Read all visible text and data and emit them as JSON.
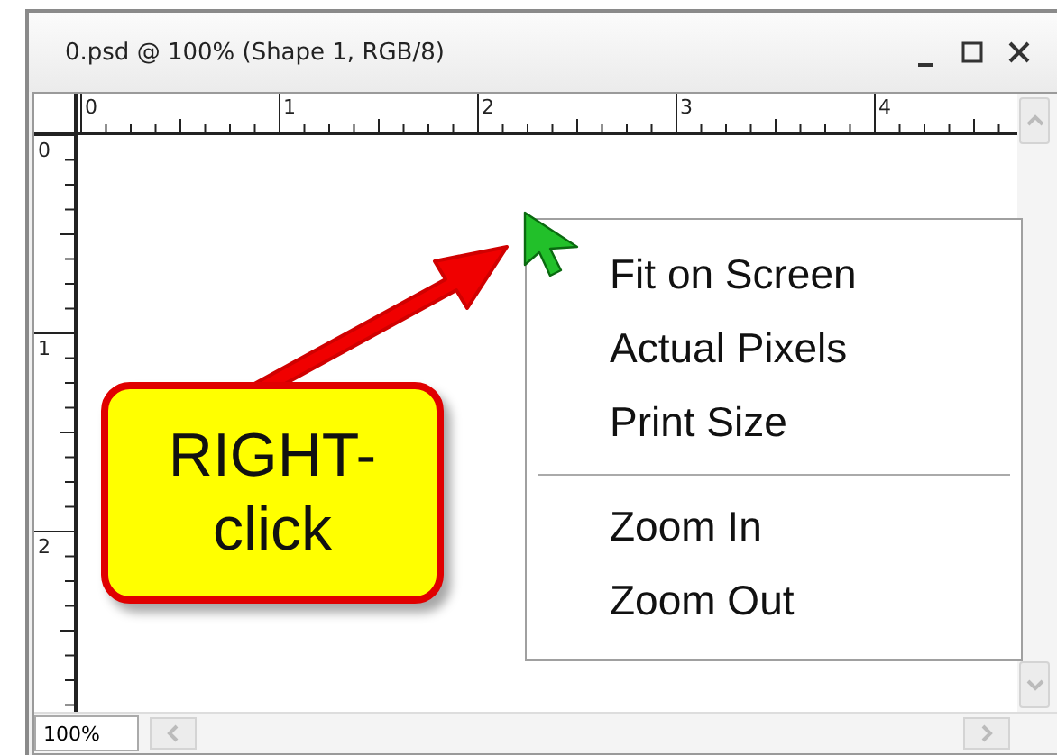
{
  "window": {
    "title": "0.psd @ 100% (Shape 1, RGB/8)"
  },
  "rulers": {
    "horizontal": [
      "0",
      "1",
      "2",
      "3",
      "4"
    ],
    "vertical": [
      "0",
      "1",
      "2"
    ]
  },
  "callout": {
    "lines": [
      "RIGHT-",
      "click"
    ]
  },
  "context_menu": {
    "items": [
      {
        "kind": "item",
        "label": "Fit on Screen"
      },
      {
        "kind": "item",
        "label": "Actual Pixels"
      },
      {
        "kind": "item",
        "label": "Print Size"
      },
      {
        "kind": "separator"
      },
      {
        "kind": "item",
        "label": "Zoom In"
      },
      {
        "kind": "item",
        "label": "Zoom Out"
      }
    ]
  },
  "zoom_field": {
    "value": "100%"
  }
}
